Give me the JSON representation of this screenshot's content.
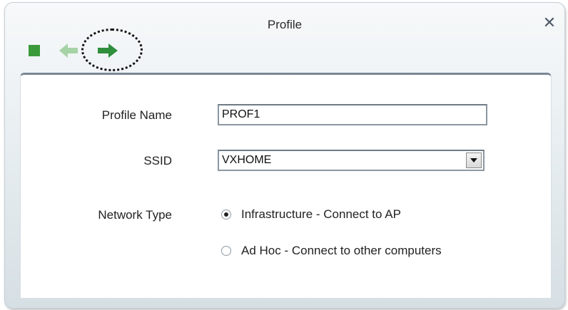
{
  "window": {
    "title": "Profile",
    "close_symbol": "✕"
  },
  "toolbar": {
    "items": [
      {
        "name": "stop-icon",
        "color": "#3a9a3a"
      },
      {
        "name": "back-arrow-icon",
        "color": "#a6d3a6"
      },
      {
        "name": "next-arrow-icon",
        "color": "#2f8f3d"
      }
    ]
  },
  "form": {
    "profile_name_label": "Profile Name",
    "profile_name_value": "PROF1",
    "ssid_label": "SSID",
    "ssid_value": "VXHOME",
    "network_type_label": "Network Type",
    "options": [
      {
        "label": "Infrastructure - Connect to AP",
        "checked": true
      },
      {
        "label": "Ad Hoc - Connect to other computers",
        "checked": false
      }
    ]
  }
}
